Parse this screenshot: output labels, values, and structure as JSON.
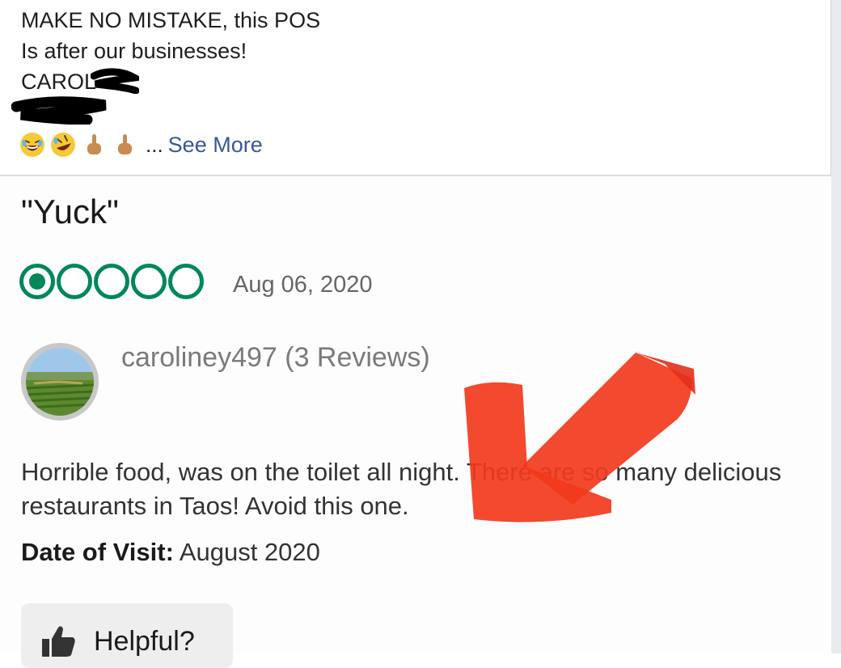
{
  "post": {
    "lines": [
      "MAKE NO MISTAKE, this POS",
      "Is after our businesses!",
      "CAROL"
    ],
    "see_more_prefix": "...",
    "see_more": "See More",
    "reaction_icons": [
      "laughing-emoji-icon",
      "rofl-emoji-icon",
      "middle-finger-icon",
      "middle-finger-icon"
    ]
  },
  "review": {
    "title": "\"Yuck\"",
    "rating": 1,
    "rating_max": 5,
    "date": "Aug 06, 2020",
    "reviewer": "caroliney497 (3 Reviews)",
    "body": "Horrible food, was on the toilet all night.  There are so many delicious restaurants in Taos! Avoid this one.",
    "visit_label": "Date of Visit:",
    "visit_value": "August 2020",
    "helpful_label": "Helpful?"
  },
  "colors": {
    "rating_green": "#00875a",
    "link_blue": "#385898",
    "arrow_red": "#f23a1c"
  }
}
